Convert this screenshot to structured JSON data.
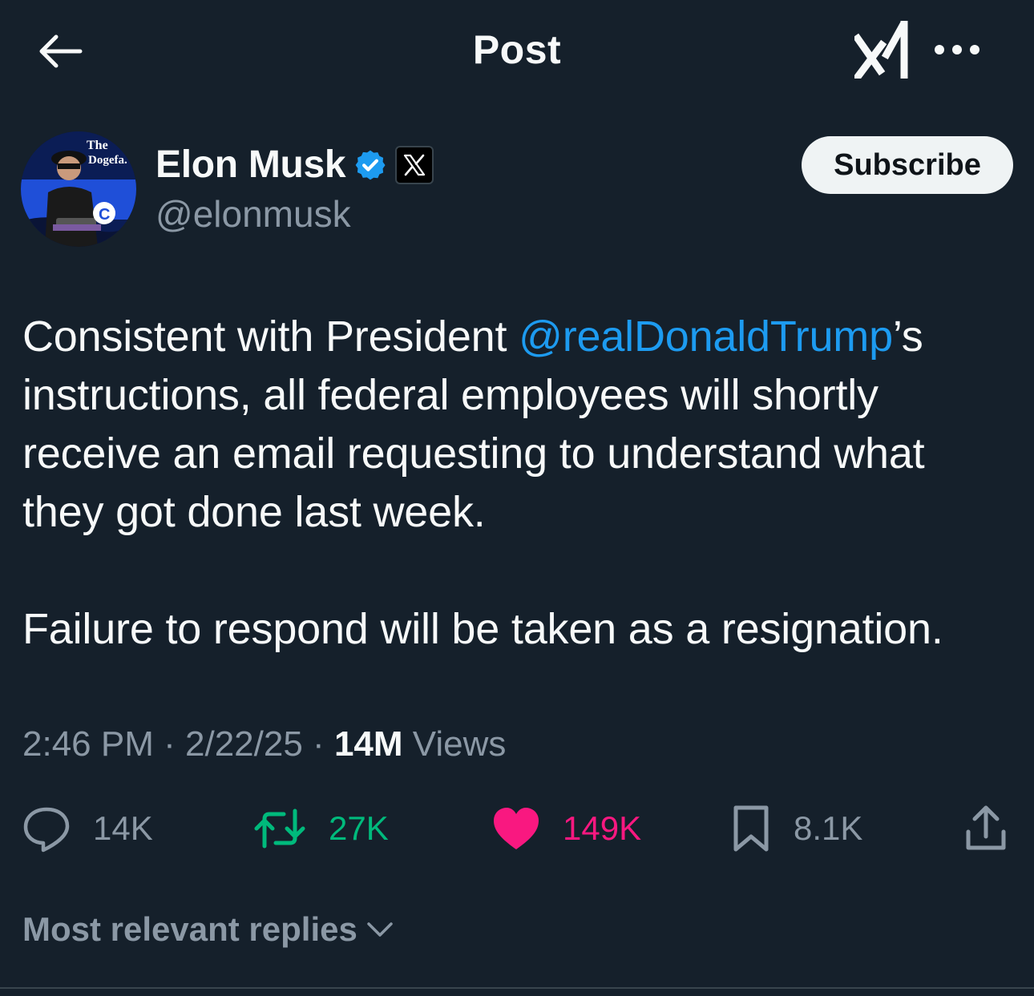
{
  "header": {
    "title": "Post",
    "back_icon": "arrow-left-icon",
    "grok_icon": "grok-icon",
    "more_icon": "more-horizontal-icon"
  },
  "author": {
    "name": "Elon Musk",
    "handle": "@elonmusk",
    "verified": true,
    "affiliation_badge": "X",
    "avatar_text": "The Dogefa.",
    "subscribe_label": "Subscribe"
  },
  "post": {
    "text_before_mention": "Consistent with President ",
    "mention": "@realDonaldTrump",
    "text_after_mention": "’s instructions, all federal employees will shortly receive an email requesting to understand what they got done last week.",
    "paragraph2": "Failure to respond will be taken as a resignation."
  },
  "meta": {
    "time": "2:46 PM",
    "separator": "·",
    "date": "2/22/25",
    "views_count": "14M",
    "views_label": "Views"
  },
  "actions": {
    "replies": "14K",
    "reposts": "27K",
    "likes": "149K",
    "bookmarks": "8.1K"
  },
  "replies_sort": {
    "label": "Most relevant replies"
  },
  "colors": {
    "background": "#15202b",
    "text": "#f7f9f9",
    "muted": "#8b98a5",
    "link": "#1d9bf0",
    "repost": "#00ba7c",
    "like": "#f91880"
  }
}
